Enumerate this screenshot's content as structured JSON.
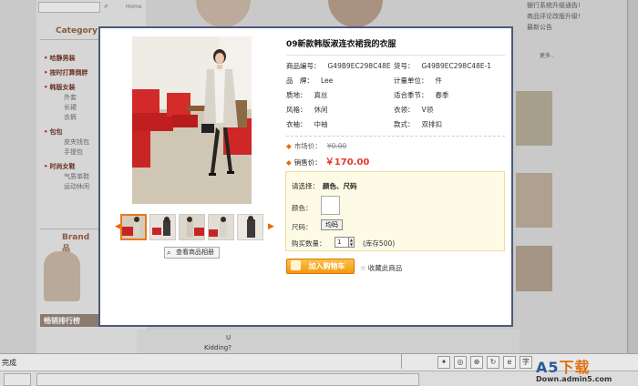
{
  "background": {
    "search_icon": "search-icon",
    "home_label": "Home",
    "category_title": "Category",
    "categories": [
      {
        "label": "哈静男装",
        "subs": []
      },
      {
        "label": "按时打算倒胖",
        "subs": []
      },
      {
        "label": "韩版女装",
        "subs": [
          "外套",
          "长裙",
          "衣裤"
        ]
      },
      {
        "label": "包包",
        "subs": [
          "皮夹钱包",
          "手提包"
        ]
      },
      {
        "label": "时尚女鞋",
        "subs": [
          "气质单鞋",
          "运动休闲"
        ]
      }
    ],
    "brand_title": "Brand 品",
    "rank_title": "畅销排行榜",
    "notices": [
      "银行系统升级通告!",
      "商品评论改版升级!",
      "最新公告"
    ],
    "more_label": "更多..",
    "kidding": "Kidding?",
    "u_label": "U"
  },
  "statusbar": {
    "status_text": "完成"
  },
  "watermark": {
    "brand_a": "A5",
    "brand_b": "下载",
    "url": "Down.admin5.com"
  },
  "product": {
    "title": "09新款韩版淑连衣裙我的衣服",
    "attributes": {
      "sku_label": "商品编号：",
      "sku_value": "G49B9EC298C48E",
      "model_label": "货号：",
      "model_value": "G49B9EC298C48E-1",
      "brand_label": "品　牌：",
      "brand_value": "Lee",
      "unit_label": "计量单位：",
      "unit_value": "件",
      "material_label": "质地：",
      "material_value": "真丝",
      "season_label": "适合季节：",
      "season_value": "春季",
      "style_label": "风格：",
      "style_value": "休闲",
      "collar_label": "衣领：",
      "collar_value": "V领",
      "sleeve_label": "衣袖：",
      "sleeve_value": "中袖",
      "cut_label": "款式：",
      "cut_value": "双排扣"
    },
    "market_price_label": "市场价：",
    "market_price": "¥0.00",
    "sale_price_label": "销售价：",
    "sale_price": "￥170.00",
    "option_prompt": "请选择：",
    "option_names": "颜色、尺码",
    "color_label": "颜色：",
    "size_label": "尺码：",
    "size_value": "均码",
    "qty_label": "购买数量：",
    "qty_value": "1",
    "stock_text": "(库存500)",
    "add_cart_label": "加入购物车",
    "favorite_label": "收藏此商品",
    "album_label": "查看商品相册"
  },
  "colors": {
    "accent_orange": "#f29a0e",
    "price_red": "#e4392b",
    "modal_border": "#4a5a7a"
  }
}
